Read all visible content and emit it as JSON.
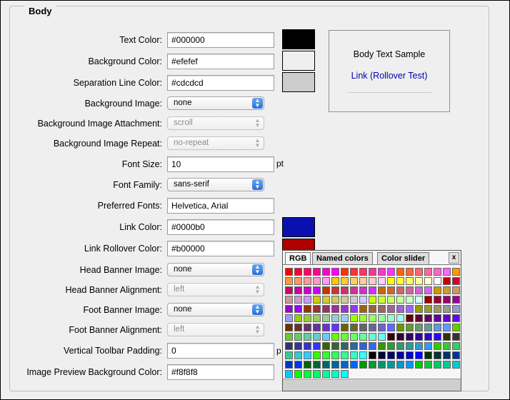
{
  "section": {
    "title": "Body"
  },
  "fields": {
    "text_color": {
      "label": "Text Color:",
      "value": "#000000",
      "swatch": "#000000"
    },
    "background_color": {
      "label": "Background Color:",
      "value": "#efefef",
      "swatch": "#efefef"
    },
    "separation_line_color": {
      "label": "Separation Line Color:",
      "value": "#cdcdcd",
      "swatch": "#cdcdcd"
    },
    "background_image": {
      "label": "Background Image:",
      "value": "none"
    },
    "background_image_attachment": {
      "label": "Background Image Attachment:",
      "value": "scroll"
    },
    "background_image_repeat": {
      "label": "Background Image Repeat:",
      "value": "no-repeat"
    },
    "font_size": {
      "label": "Font Size:",
      "value": "10",
      "unit": "pt"
    },
    "font_family": {
      "label": "Font Family:",
      "value": "sans-serif"
    },
    "preferred_fonts": {
      "label": "Preferred Fonts:",
      "value": "Helvetica, Arial"
    },
    "link_color": {
      "label": "Link Color:",
      "value": "#0000b0",
      "swatch": "#0a10b0"
    },
    "link_rollover_color": {
      "label": "Link Rollover Color:",
      "value": "#b00000",
      "swatch": "#b00000"
    },
    "head_banner_image": {
      "label": "Head Banner Image:",
      "value": "none"
    },
    "head_banner_alignment": {
      "label": "Head Banner Alignment:",
      "value": "left"
    },
    "foot_banner_image": {
      "label": "Foot Banner Image:",
      "value": "none"
    },
    "foot_banner_alignment": {
      "label": "Foot Banner Alignment:",
      "value": "left"
    },
    "vertical_toolbar_padding": {
      "label": "Vertical Toolbar Padding:",
      "value": "0",
      "unit": "p"
    },
    "image_preview_background_color": {
      "label": "Image Preview Background Color:",
      "value": "#f8f8f8"
    }
  },
  "preview": {
    "body_text": "Body Text Sample",
    "link_text": "Link (Rollover Test)"
  },
  "color_picker": {
    "tabs": [
      "RGB",
      "Named colors",
      "Color slider"
    ],
    "close": "x",
    "rows": [
      [
        "#ff0000",
        "#ff0033",
        "#ff0066",
        "#ff0099",
        "#ff00cc",
        "#ff00ff",
        "#ff3300",
        "#ff3333",
        "#ff3366",
        "#ff3399",
        "#ff33cc",
        "#ff33ff",
        "#ff6600",
        "#ff6633",
        "#ff6666",
        "#ff6699",
        "#ff66cc",
        "#ff66ff",
        "#ff9900"
      ],
      [
        "#ff9933",
        "#ff9966",
        "#ff9999",
        "#ff99cc",
        "#ff99ff",
        "#ffcc00",
        "#ffcc33",
        "#ffcc66",
        "#ffcc99",
        "#ffcccc",
        "#ffccff",
        "#ffff00",
        "#ffff33",
        "#ffff66",
        "#ffff99",
        "#ffffcc",
        "#ffffff",
        "#cc0000",
        "#cc0033"
      ],
      [
        "#cc0066",
        "#cc0099",
        "#cc00cc",
        "#cc00ff",
        "#cc3300",
        "#cc3333",
        "#cc3366",
        "#cc3399",
        "#cc33cc",
        "#cc33ff",
        "#cc6600",
        "#cc6633",
        "#cc6666",
        "#cc6699",
        "#cc66cc",
        "#cc66ff",
        "#cc9900",
        "#cc9933",
        "#cc9966"
      ],
      [
        "#cc9999",
        "#cc99cc",
        "#cc99ff",
        "#cccc00",
        "#cccc33",
        "#cccc66",
        "#cccc99",
        "#cccccc",
        "#ccccff",
        "#ccff00",
        "#ccff33",
        "#ccff66",
        "#ccff99",
        "#ccffcc",
        "#ccffff",
        "#990000",
        "#990033",
        "#990066",
        "#990099"
      ],
      [
        "#9900cc",
        "#9900ff",
        "#993300",
        "#993333",
        "#993366",
        "#993399",
        "#9933cc",
        "#9933ff",
        "#996600",
        "#996633",
        "#996666",
        "#996699",
        "#9966cc",
        "#9966ff",
        "#999900",
        "#999933",
        "#999966",
        "#999999",
        "#9999cc"
      ],
      [
        "#9999ff",
        "#99cc00",
        "#99cc33",
        "#99cc66",
        "#99cc99",
        "#99cccc",
        "#99ccff",
        "#99ff00",
        "#99ff33",
        "#99ff66",
        "#99ff99",
        "#99ffcc",
        "#99ffff",
        "#660000",
        "#660033",
        "#660066",
        "#660099",
        "#6600cc",
        "#6600ff"
      ],
      [
        "#663300",
        "#663333",
        "#663366",
        "#663399",
        "#6633cc",
        "#6633ff",
        "#666600",
        "#666633",
        "#666666",
        "#666699",
        "#6666cc",
        "#6666ff",
        "#669900",
        "#669933",
        "#669966",
        "#669999",
        "#6699cc",
        "#6699ff",
        "#66cc00"
      ],
      [
        "#66cc33",
        "#66cc66",
        "#66cc99",
        "#66cccc",
        "#66ccff",
        "#66ff00",
        "#66ff33",
        "#66ff66",
        "#66ff99",
        "#66ffcc",
        "#66ffff",
        "#330000",
        "#330033",
        "#330066",
        "#330099",
        "#3300cc",
        "#3300ff",
        "#333300",
        "#333333"
      ],
      [
        "#333366",
        "#333399",
        "#3333cc",
        "#3333ff",
        "#336600",
        "#336633",
        "#336666",
        "#336699",
        "#3366cc",
        "#3366ff",
        "#339900",
        "#339933",
        "#339966",
        "#339999",
        "#3399cc",
        "#3399ff",
        "#33cc00",
        "#33cc33",
        "#33cc66"
      ],
      [
        "#33cc99",
        "#33cccc",
        "#33ccff",
        "#33ff00",
        "#33ff33",
        "#33ff66",
        "#33ff99",
        "#33ffcc",
        "#33ffff",
        "#000000",
        "#000033",
        "#000066",
        "#000099",
        "#0000cc",
        "#0000ff",
        "#003300",
        "#003333",
        "#003366",
        "#003399"
      ],
      [
        "#0033cc",
        "#0033ff",
        "#006600",
        "#006633",
        "#006666",
        "#006699",
        "#0066cc",
        "#0066ff",
        "#009900",
        "#009933",
        "#009966",
        "#009999",
        "#0099cc",
        "#0099ff",
        "#00cc00",
        "#00cc33",
        "#00cc66",
        "#00cc99",
        "#00cccc"
      ],
      [
        "#00ccff",
        "#00ff00",
        "#00ff33",
        "#00ff66",
        "#00ff99",
        "#00ffcc",
        "#00ffff"
      ]
    ]
  }
}
